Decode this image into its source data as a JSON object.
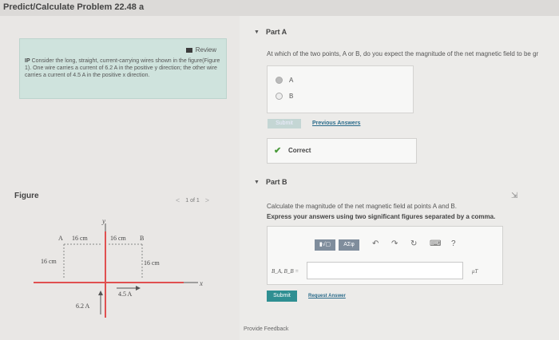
{
  "window": {
    "title": "Predict/Calculate Problem 22.48 a"
  },
  "left": {
    "review_label": "Review",
    "problem_prefix": "IP",
    "problem_text": "Consider the long, straight, current-carrying wires shown in the figure(Figure 1). One wire carries a current of 6.2 A in the positive y direction; the other wire carries a current of 4.5 A in the positive x direction.",
    "figure_label": "Figure",
    "pager": {
      "prev": "<",
      "text": "1 of 1",
      "next": ">"
    },
    "figure": {
      "label_A": "A",
      "label_B": "B",
      "dist_A_wire": "16 cm",
      "dist_wire_B": "16 cm",
      "dist_A_down": "16 cm",
      "dist_B_down": "16 cm",
      "y_axis": "y",
      "x_axis": "x",
      "current_y": "6.2 A",
      "current_x": "4.5 A"
    }
  },
  "partA": {
    "label": "Part A",
    "question": "At which of the two points, A or B, do you expect the magnitude of the net magnetic field to be gr",
    "options": [
      "A",
      "B"
    ],
    "selected": "A",
    "submit_label": "Submit",
    "previous_answers": "Previous Answers",
    "status": "Correct"
  },
  "partB": {
    "label": "Part B",
    "question": "Calculate the magnitude of the net magnetic field at points A and B.",
    "instruction": "Express your answers using two significant figures separated by a comma.",
    "toolbar": {
      "templates_label": "▮√▢",
      "greek_label": "ΑΣφ",
      "help": "?"
    },
    "input_label": "B_A, B_B =",
    "input_value": "",
    "unit": "μT",
    "submit_label": "Submit",
    "request_answer": "Request Answer"
  },
  "footer": {
    "feedback": "Provide Feedback"
  },
  "colors": {
    "accent": "#2f8f92",
    "review_bg": "#cfe3dd",
    "correct": "#4a9a3a"
  }
}
